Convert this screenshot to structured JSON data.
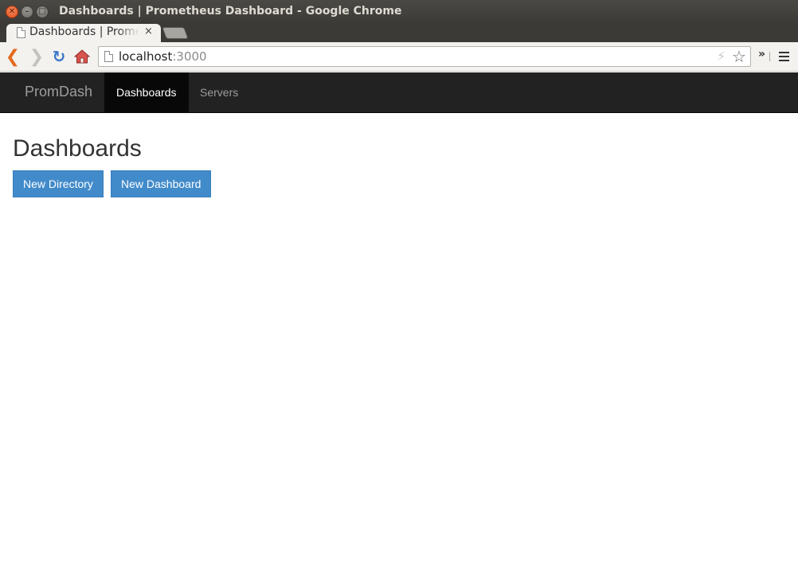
{
  "window": {
    "title": "Dashboards | Prometheus Dashboard - Google Chrome",
    "close_glyph": "✕",
    "minimize_glyph": "–",
    "maximize_glyph": "□"
  },
  "tab": {
    "title": "Dashboards | Prometheus Dashboard",
    "close_glyph": "×"
  },
  "toolbar": {
    "back_glyph": "❮",
    "forward_glyph": "❯",
    "reload_glyph": "↻",
    "url_host": "localhost",
    "url_port": ":3000",
    "bolt_glyph": "⚡",
    "star_glyph": "☆",
    "extensions_glyph": "»",
    "icons": [
      "back-icon",
      "forward-icon",
      "reload-icon",
      "home-icon",
      "page-icon",
      "bolt-icon",
      "star-icon",
      "menu-icon"
    ]
  },
  "navbar": {
    "brand": "PromDash",
    "items": [
      {
        "label": "Dashboards",
        "active": true
      },
      {
        "label": "Servers",
        "active": false
      }
    ]
  },
  "main": {
    "title": "Dashboards",
    "buttons": {
      "new_directory": "New Directory",
      "new_dashboard": "New Dashboard"
    }
  },
  "colors": {
    "navbar_bg": "#222222",
    "nav_active_bg": "#080808",
    "nav_text": "#9d9d9d",
    "button_primary": "#428bca",
    "title_text": "#333333"
  }
}
